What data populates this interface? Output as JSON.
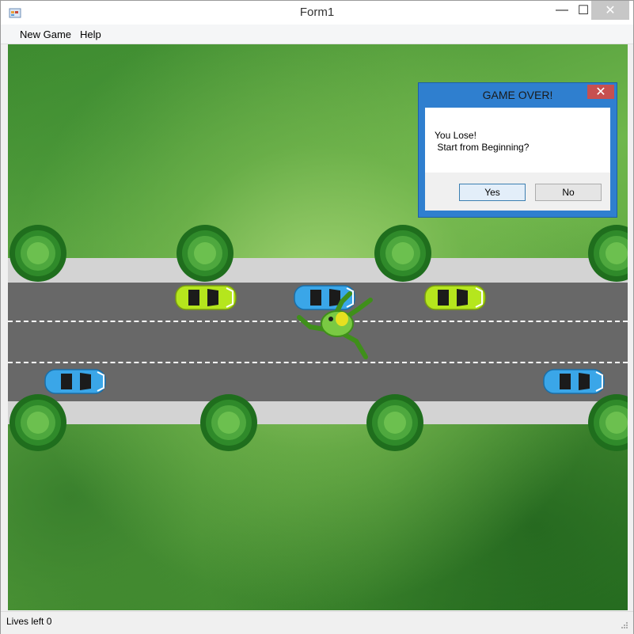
{
  "window": {
    "title": "Form1",
    "min_symbol": "—",
    "max_symbol": "☐",
    "close_symbol": "✕"
  },
  "menu": {
    "items": [
      "New Game",
      "Help"
    ]
  },
  "dialog": {
    "title": "GAME OVER!",
    "close_symbol": "✕",
    "message_line1": "You Lose!",
    "message_line2": " Start from Beginning?",
    "yes_label": "Yes",
    "no_label": "No"
  },
  "status": {
    "lives_text": "Lives left 0"
  },
  "colors": {
    "road": "#686868",
    "sidewalk": "#d3d3d3",
    "dialog_accent": "#2f7fcf",
    "car_lime": "#b5e61d",
    "car_blue": "#3aa6e8"
  },
  "icons": {
    "app": "app-icon",
    "tree": "tree-icon",
    "car": "car-icon",
    "frog": "frog-icon"
  }
}
